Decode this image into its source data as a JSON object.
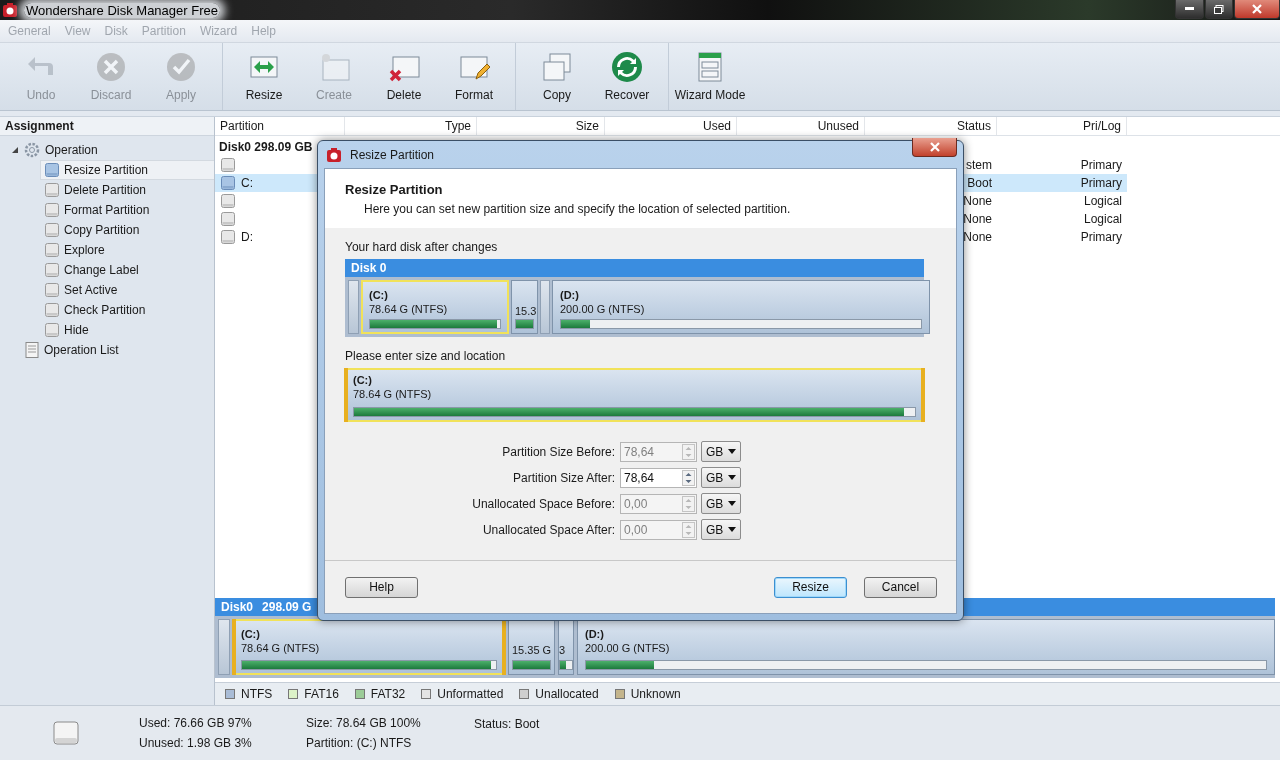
{
  "window": {
    "title": "Wondershare Disk Manager Free"
  },
  "menu": [
    "General",
    "View",
    "Disk",
    "Partition",
    "Wizard",
    "Help"
  ],
  "toolbar": [
    [
      {
        "label": "Undo",
        "disabled": true
      },
      {
        "label": "Discard",
        "disabled": true
      },
      {
        "label": "Apply",
        "disabled": true
      }
    ],
    [
      {
        "label": "Resize",
        "disabled": false
      },
      {
        "label": "Create",
        "disabled": true
      },
      {
        "label": "Delete",
        "disabled": false
      },
      {
        "label": "Format",
        "disabled": false
      }
    ],
    [
      {
        "label": "Copy",
        "disabled": false
      },
      {
        "label": "Recover",
        "disabled": false
      }
    ],
    [
      {
        "label": "Wizard Mode",
        "disabled": false
      }
    ]
  ],
  "sidebar": {
    "title": "Assignment",
    "items": [
      {
        "label": "Operation",
        "expanded": true,
        "children": [
          {
            "label": "Resize Partition",
            "selected": true
          },
          {
            "label": "Delete Partition",
            "selected": false
          },
          {
            "label": "Format Partition",
            "selected": false
          },
          {
            "label": "Copy Partition",
            "selected": false
          },
          {
            "label": "Explore",
            "selected": false
          },
          {
            "label": "Change Label",
            "selected": false
          },
          {
            "label": "Set Active",
            "selected": false
          },
          {
            "label": "Check Partition",
            "selected": false
          },
          {
            "label": "Hide",
            "selected": false
          }
        ]
      },
      {
        "label": "Operation List"
      }
    ]
  },
  "table": {
    "columns": [
      "Partition",
      "Type",
      "Size",
      "Used",
      "Unused",
      "Status",
      "Pri/Log"
    ],
    "rows": [
      {
        "kind": "disk",
        "partition": "Disk0 298.09 GB"
      },
      {
        "kind": "partition",
        "partition": "",
        "status": "stem",
        "pri_log": "Primary",
        "selected": false
      },
      {
        "kind": "partition",
        "partition": "C:",
        "status": "Boot",
        "pri_log": "Primary",
        "selected": true
      },
      {
        "kind": "partition",
        "partition": "",
        "status": "None",
        "pri_log": "Logical",
        "selected": false
      },
      {
        "kind": "partition",
        "partition": "",
        "status": "None",
        "pri_log": "Logical",
        "selected": false
      },
      {
        "kind": "partition",
        "partition": "D:",
        "status": "None",
        "pri_log": "Primary",
        "selected": false
      }
    ]
  },
  "disk_map": {
    "name": "Disk0",
    "size": "298.09 G",
    "partitions": [
      {
        "kind": "sliver"
      },
      {
        "kind": "partition",
        "label": "(C:)",
        "size": "78.64 G  (NTFS)",
        "level": 0.98,
        "selected": true
      },
      {
        "kind": "small",
        "size": "15.35 G",
        "level": 1,
        "selected": false
      },
      {
        "kind": "small",
        "size": "3",
        "level": 0.5,
        "selected": false
      },
      {
        "kind": "partition",
        "label": "(D:)",
        "size": "200.00 G  (NTFS)",
        "level": 0.1,
        "selected": false
      }
    ]
  },
  "legend": [
    {
      "label": "NTFS",
      "color": "#a9bcd6"
    },
    {
      "label": "FAT16",
      "color": "#dcf2c8"
    },
    {
      "label": "FAT32",
      "color": "#9ccc98"
    },
    {
      "label": "Unformatted",
      "color": "#e4e4e4"
    },
    {
      "label": "Unallocated",
      "color": "#cfcfcf"
    },
    {
      "label": "Unknown",
      "color": "#c4b58c"
    }
  ],
  "status_bar": {
    "used": "Used: 76.66 GB  97%",
    "unused": "Unused: 1.98 GB  3%",
    "size": "Size: 78.64 GB  100%",
    "partition": "Partition: (C:) NTFS",
    "status": "Status: Boot"
  },
  "dialog": {
    "title": "Resize Partition",
    "heading": "Resize Partition",
    "description": "Here you can set new partition size and specify the location of selected partition.",
    "map_label": "Your hard disk after changes",
    "disk_map": {
      "name": "Disk 0",
      "partitions": [
        {
          "kind": "sliver"
        },
        {
          "kind": "partition",
          "label": "(C:)",
          "size": "78.64 G  (NTFS)",
          "level": 0.98,
          "selected": true
        },
        {
          "kind": "small",
          "size": "15.3",
          "level": 1,
          "selected": false
        },
        {
          "kind": "sliver"
        },
        {
          "kind": "partition",
          "label": "(D:)",
          "size": "200.00 G  (NTFS)",
          "level": 0.08,
          "selected": false
        }
      ]
    },
    "size_label": "Please enter size and location",
    "selected_partition": {
      "label": "(C:)",
      "size": "78.64 G  (NTFS)",
      "level": 0.98
    },
    "fields": [
      {
        "label": "Partition Size Before:",
        "value": "78,64",
        "disabled": true,
        "unit": "GB"
      },
      {
        "label": "Partition Size After:",
        "value": "78,64",
        "disabled": false,
        "unit": "GB"
      },
      {
        "label": "Unallocated Space Before:",
        "value": "0,00",
        "disabled": true,
        "unit": "GB"
      },
      {
        "label": "Unallocated Space After:",
        "value": "0,00",
        "disabled": true,
        "unit": "GB"
      }
    ],
    "buttons": [
      {
        "label": "Help",
        "default": false
      },
      {
        "label": "Resize",
        "default": true
      },
      {
        "label": "Cancel",
        "default": false
      }
    ]
  }
}
